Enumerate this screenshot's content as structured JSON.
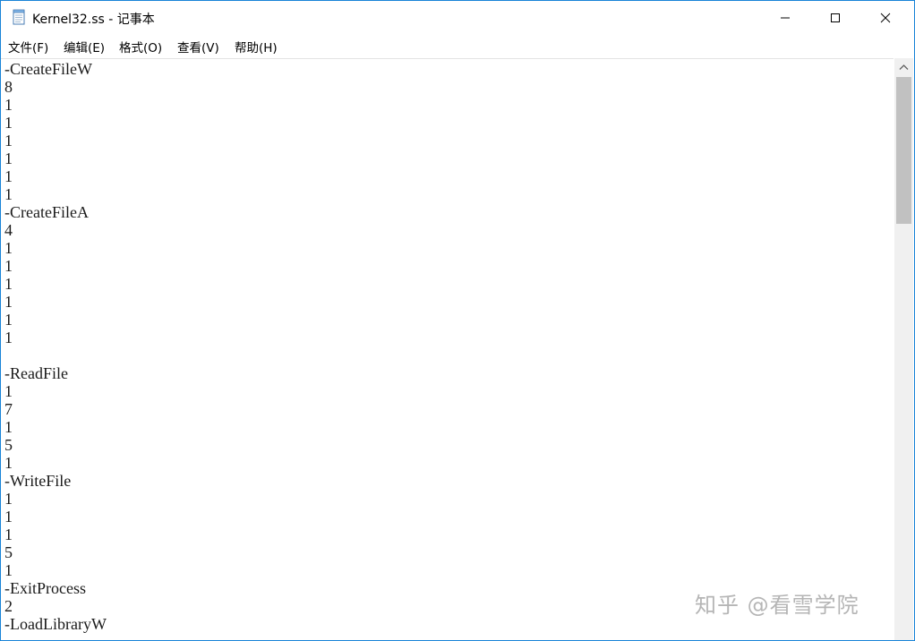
{
  "window": {
    "title": "Kernel32.ss - 记事本",
    "accent_color": "#1883d7"
  },
  "titlebar_buttons": {
    "minimize_icon": "minimize-icon",
    "maximize_icon": "maximize-icon",
    "close_icon": "close-icon"
  },
  "menu": {
    "file": "文件(F)",
    "edit": "编辑(E)",
    "format": "格式(O)",
    "view": "查看(V)",
    "help": "帮助(H)"
  },
  "editor": {
    "lines": [
      "-CreateFileW",
      "8",
      "1",
      "1",
      "1",
      "1",
      "1",
      "1",
      "-CreateFileA",
      "4",
      "1",
      "1",
      "1",
      "1",
      "1",
      "1",
      "",
      "-ReadFile",
      "1",
      "7",
      "1",
      "5",
      "1",
      "-WriteFile",
      "1",
      "1",
      "1",
      "5",
      "1",
      "-ExitProcess",
      "2",
      "-LoadLibraryW"
    ]
  },
  "watermark": "知乎 @看雪学院"
}
